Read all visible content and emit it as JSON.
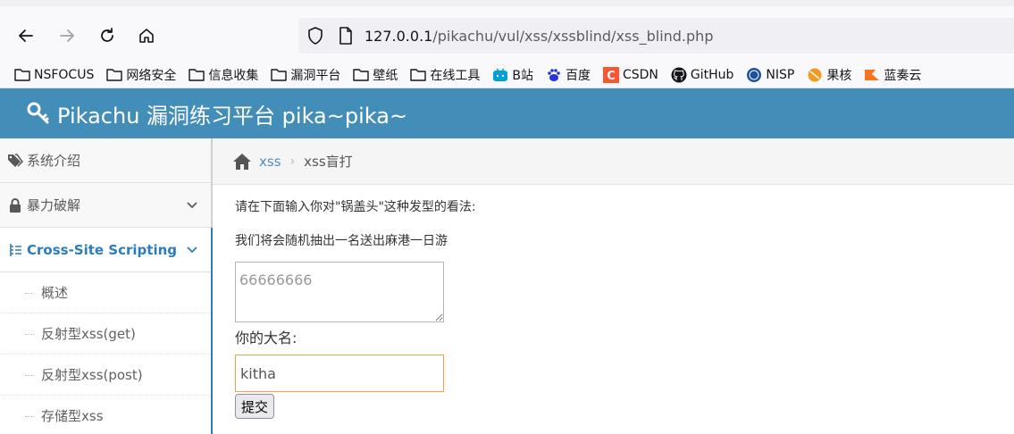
{
  "browser": {
    "url_host": "127.0.0.1",
    "url_path": "/pikachu/vul/xss/xssblind/xss_blind.php",
    "bookmarks": [
      {
        "label": "NSFOCUS",
        "icon": "folder-icon"
      },
      {
        "label": "网络安全",
        "icon": "folder-icon"
      },
      {
        "label": "信息收集",
        "icon": "folder-icon"
      },
      {
        "label": "漏洞平台",
        "icon": "folder-icon"
      },
      {
        "label": "壁纸",
        "icon": "folder-icon"
      },
      {
        "label": "在线工具",
        "icon": "folder-icon"
      },
      {
        "label": "B站",
        "icon": "bilibili-icon"
      },
      {
        "label": "百度",
        "icon": "baidu-icon"
      },
      {
        "label": "CSDN",
        "icon": "csdn-icon"
      },
      {
        "label": "GitHub",
        "icon": "github-icon"
      },
      {
        "label": "NISP",
        "icon": "nisp-icon"
      },
      {
        "label": "果核",
        "icon": "guohe-icon"
      },
      {
        "label": "蓝奏云",
        "icon": "lanzou-icon"
      }
    ]
  },
  "header": {
    "title": "Pikachu 漏洞练习平台 pika~pika~",
    "bg_color": "#438eb9"
  },
  "sidebar": {
    "items": [
      {
        "label": "系统介绍"
      },
      {
        "label": "暴力破解"
      },
      {
        "label": "Cross-Site Scripting"
      }
    ],
    "subitems": [
      {
        "label": "概述"
      },
      {
        "label": "反射型xss(get)"
      },
      {
        "label": "反射型xss(post)"
      },
      {
        "label": "存储型xss"
      }
    ]
  },
  "breadcrumb": {
    "link": "xss",
    "sep": "›",
    "current": "xss盲打"
  },
  "form": {
    "prompt1": "请在下面输入你对\"锅盖头\"这种发型的看法:",
    "prompt2": "我们将会随机抽出一名送出麻港一日游",
    "message_placeholder": "66666666",
    "name_label": "你的大名:",
    "name_value": "kitha",
    "submit_label": "提交"
  }
}
